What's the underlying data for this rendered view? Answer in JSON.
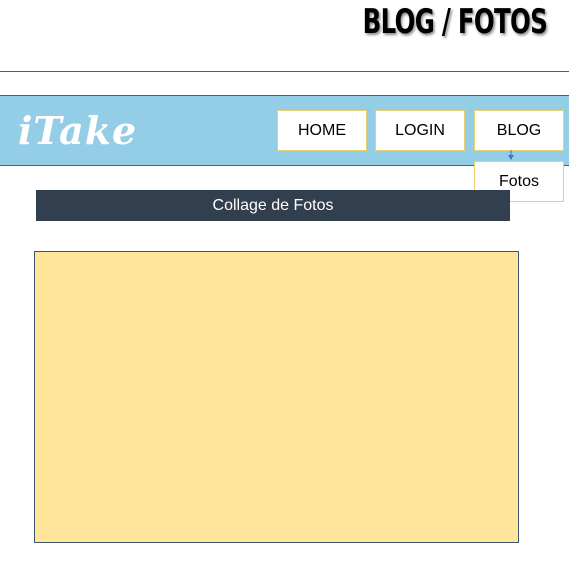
{
  "page": {
    "heading": "BLOG / FOTOS"
  },
  "header": {
    "logo": "iTake",
    "nav": {
      "home_label": "HOME",
      "login_label": "LOGIN",
      "blog_label": "BLOG"
    },
    "blog_dropdown": {
      "items": [
        "Fotos"
      ]
    }
  },
  "main": {
    "section_title": "Collage de Fotos"
  },
  "colors": {
    "nav_bar": "#93cde6",
    "nav_border": "#3e6185",
    "button_border": "#e7cf74",
    "section_header": "#323f4f",
    "collage_fill": "#ffe599"
  },
  "icons": {
    "dropdown_indicator": "arrow-down-icon"
  }
}
